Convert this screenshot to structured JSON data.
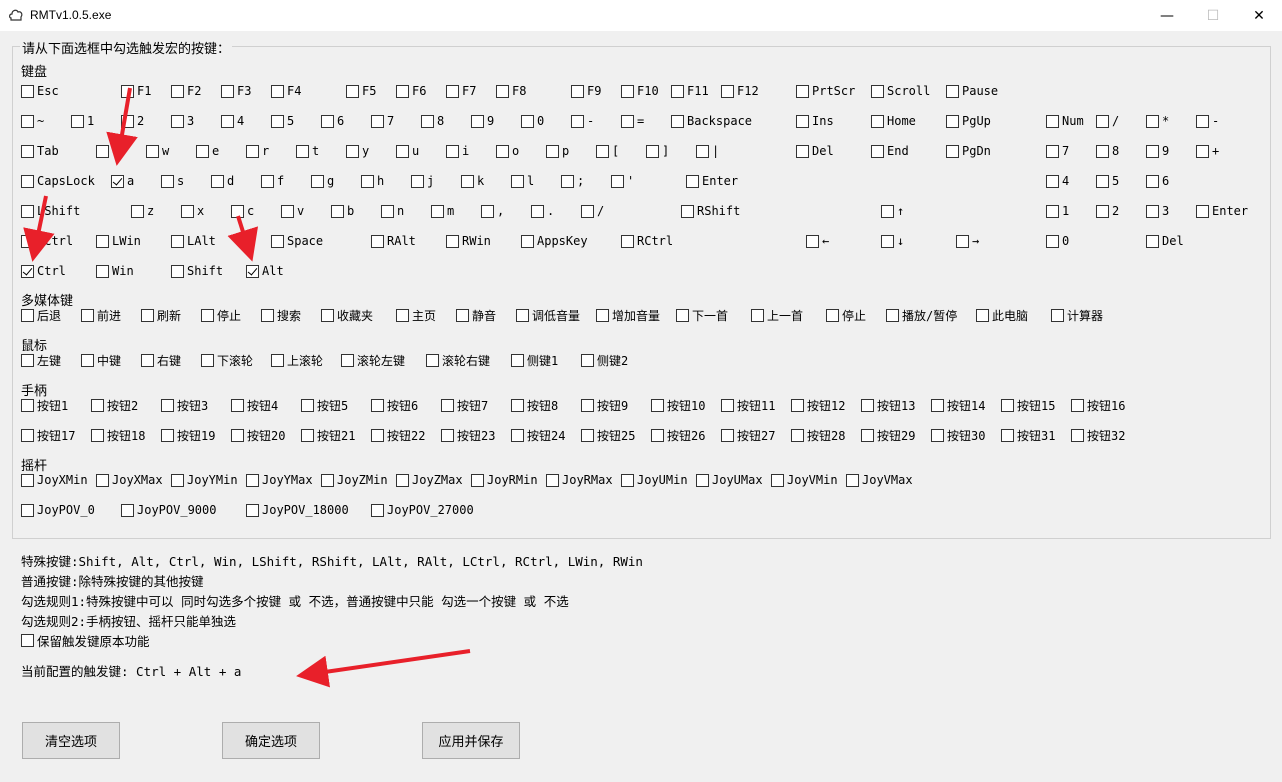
{
  "window": {
    "title": "RMTv1.0.5.exe",
    "minimize": "—",
    "maximize": "☐",
    "close": "✕"
  },
  "group_label": "请从下面选框中勾选触发宏的按键：",
  "sections": {
    "keyboard": "键盘",
    "media": "多媒体键",
    "mouse": "鼠标",
    "gamepad": "手柄",
    "joystick": "摇杆"
  },
  "keyboard_rows": [
    [
      "Esc",
      "F1",
      "F2",
      "F3",
      "F4",
      "F5",
      "F6",
      "F7",
      "F8",
      "F9",
      "F10",
      "F11",
      "F12",
      "PrtScr",
      "Scroll",
      "Pause"
    ],
    [
      "~",
      "1",
      "2",
      "3",
      "4",
      "5",
      "6",
      "7",
      "8",
      "9",
      "0",
      "-",
      "=",
      "Backspace",
      "Ins",
      "Home",
      "PgUp",
      "Num",
      "/",
      "*",
      "-"
    ],
    [
      "Tab",
      "q",
      "w",
      "e",
      "r",
      "t",
      "y",
      "u",
      "i",
      "o",
      "p",
      "[",
      "]",
      "|",
      "Del",
      "End",
      "PgDn",
      "7",
      "8",
      "9",
      "+"
    ],
    [
      "CapsLock",
      "a",
      "s",
      "d",
      "f",
      "g",
      "h",
      "j",
      "k",
      "l",
      ";",
      "'",
      "Enter",
      "4",
      "5",
      "6"
    ],
    [
      "LShift",
      "z",
      "x",
      "c",
      "v",
      "b",
      "n",
      "m",
      ",",
      ".",
      "/",
      "RShift",
      "↑",
      "1",
      "2",
      "3",
      "Enter"
    ],
    [
      "LCtrl",
      "LWin",
      "LAlt",
      "Space",
      "RAlt",
      "RWin",
      "AppsKey",
      "RCtrl",
      "←",
      "↓",
      "→",
      "0",
      "Del"
    ],
    [
      "Ctrl",
      "Win",
      "Shift",
      "Alt"
    ]
  ],
  "keyboard_checked": {
    "3": [
      1
    ],
    "6": [
      0,
      3
    ]
  },
  "media_keys": [
    "后退",
    "前进",
    "刷新",
    "停止",
    "搜索",
    "收藏夹",
    "主页",
    "静音",
    "调低音量",
    "增加音量",
    "下一首",
    "上一首",
    "停止",
    "播放/暂停",
    "此电脑",
    "计算器"
  ],
  "mouse_keys": [
    "左键",
    "中键",
    "右键",
    "下滚轮",
    "上滚轮",
    "滚轮左键",
    "滚轮右键",
    "侧键1",
    "侧键2"
  ],
  "gamepad_rows": [
    [
      "按钮1",
      "按钮2",
      "按钮3",
      "按钮4",
      "按钮5",
      "按钮6",
      "按钮7",
      "按钮8",
      "按钮9",
      "按钮10",
      "按钮11",
      "按钮12",
      "按钮13",
      "按钮14",
      "按钮15",
      "按钮16"
    ],
    [
      "按钮17",
      "按钮18",
      "按钮19",
      "按钮20",
      "按钮21",
      "按钮22",
      "按钮23",
      "按钮24",
      "按钮25",
      "按钮26",
      "按钮27",
      "按钮28",
      "按钮29",
      "按钮30",
      "按钮31",
      "按钮32"
    ]
  ],
  "joystick_rows": [
    [
      "JoyXMin",
      "JoyXMax",
      "JoyYMin",
      "JoyYMax",
      "JoyZMin",
      "JoyZMax",
      "JoyRMin",
      "JoyRMax",
      "JoyUMin",
      "JoyUMax",
      "JoyVMin",
      "JoyVMax"
    ],
    [
      "JoyPOV_0",
      "JoyPOV_9000",
      "JoyPOV_18000",
      "JoyPOV_27000"
    ]
  ],
  "info": {
    "special": "特殊按键:Shift, Alt, Ctrl, Win, LShift, RShift, LAlt, RAlt, LCtrl, RCtrl, LWin, RWin",
    "normal": "普通按键:除特殊按键的其他按键",
    "rule1": "勾选规则1:特殊按键中可以 同时勾选多个按键 或 不选，普通按键中只能 勾选一个按键 或 不选",
    "rule2": "勾选规则2:手柄按钮、摇杆只能单独选",
    "keep_label": "保留触发键原本功能",
    "current": "当前配置的触发键: Ctrl  +  Alt  +  a"
  },
  "buttons": {
    "clear": "清空选项",
    "confirm": "确定选项",
    "apply": "应用并保存"
  },
  "colors": {
    "annotation_arrow": "#e8202a"
  }
}
